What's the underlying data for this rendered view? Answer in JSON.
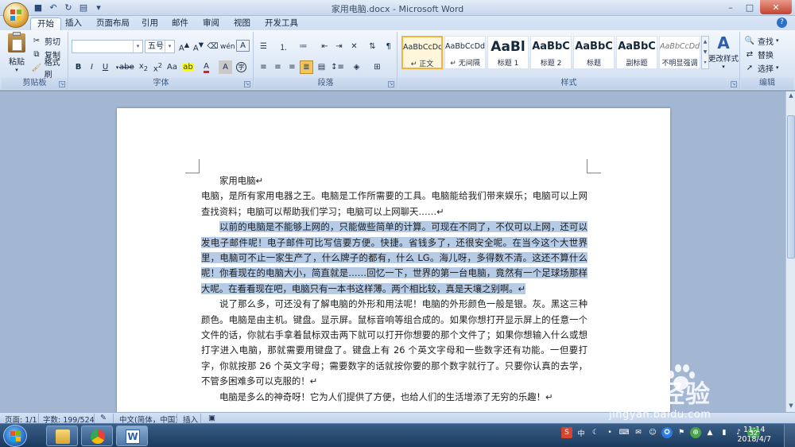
{
  "window": {
    "title": "家用电脑.docx - Microsoft Word",
    "controls": {
      "minimize": "–",
      "maximize": "□",
      "close": "✕"
    }
  },
  "ribbon_tabs": [
    "开始",
    "插入",
    "页面布局",
    "引用",
    "邮件",
    "审阅",
    "视图",
    "开发工具"
  ],
  "active_tab": "开始",
  "clipboard": {
    "label": "剪贴板",
    "paste": "粘贴",
    "cut": "剪切",
    "copy": "复制",
    "format_painter": "格式刷"
  },
  "font": {
    "label": "字体",
    "font_name": "",
    "font_size": "五号"
  },
  "paragraph": {
    "label": "段落"
  },
  "styles": {
    "label": "样式",
    "items": [
      {
        "sample": "AaBbCcDd",
        "name": "↵ 正文"
      },
      {
        "sample": "AaBbCcDd",
        "name": "↵ 无间隔"
      },
      {
        "sample": "AaBl",
        "name": "标题 1"
      },
      {
        "sample": "AaBbC",
        "name": "标题 2"
      },
      {
        "sample": "AaBbC",
        "name": "标题"
      },
      {
        "sample": "AaBbC",
        "name": "副标题"
      },
      {
        "sample": "AaBbCcDd",
        "name": "不明显强调"
      }
    ],
    "change_styles": "更改样式"
  },
  "editing": {
    "label": "编辑",
    "find": "查找",
    "replace": "替换",
    "select": "选择"
  },
  "document": {
    "title_line": "家用电脑↵",
    "para1": "电脑，是所有家用电器之王。电脑是工作所需要的工具。电脑能给我们带来娱乐；电脑可以上网查找资料；电脑可以帮助我们学习；电脑可以上网聊天……↵",
    "para2": "以前的电脑是不能够上网的，只能做些简单的计算。可现在不同了，不仅可以上网，还可以发电子邮件呢！电子邮件可比写信要方便。快捷。省钱多了，还很安全呢。在当今这个大世界里，电脑可不止一家生产了，什么牌子的都有，什么 LG。海儿呀，多得数不清。这还不算什么呢！你看现在的电脑大小，简直就是……回忆一下，世界的第一台电脑，竟然有一个足球场那样大呢。在看看现在吧，电脑只有一本书这样薄。两个相比较，真是天壤之别啊。↵",
    "para3": "说了那么多，可还没有了解电脑的外形和用法呢！电脑的外形颜色一般是银。灰。黑这三种颜色。电脑是由主机。键盘。显示屏。鼠标音响等组合成的。如果你想打开显示屏上的任意一个文件的话，你就右手拿着鼠标双击两下就可以打开你想要的那个文件了；如果你想输入什么或想打字进入电脑，那就需要用键盘了。键盘上有 26 个英文字母和一些数字还有功能。一但要打字，你就按那 26 个英文字母；需要数字的话就按你要的那个数字就行了。只要你认真的去学，不管多困难多可以克服的！↵",
    "para4": "电脑是多么的神奇呀！它为人们提供了方便，也给人们的生活增添了无穷的乐趣！↵"
  },
  "status": {
    "page": "页面: 1/1",
    "words": "字数: 199/524",
    "language": "中文(简体，中国)",
    "mode": "插入"
  },
  "taskbar": {
    "time": "11:14",
    "date": "2018/4/7",
    "ime": "中",
    "badge": "32"
  },
  "watermark": {
    "brand": "Bai 经验",
    "url": "jingyan.baidu.com"
  }
}
